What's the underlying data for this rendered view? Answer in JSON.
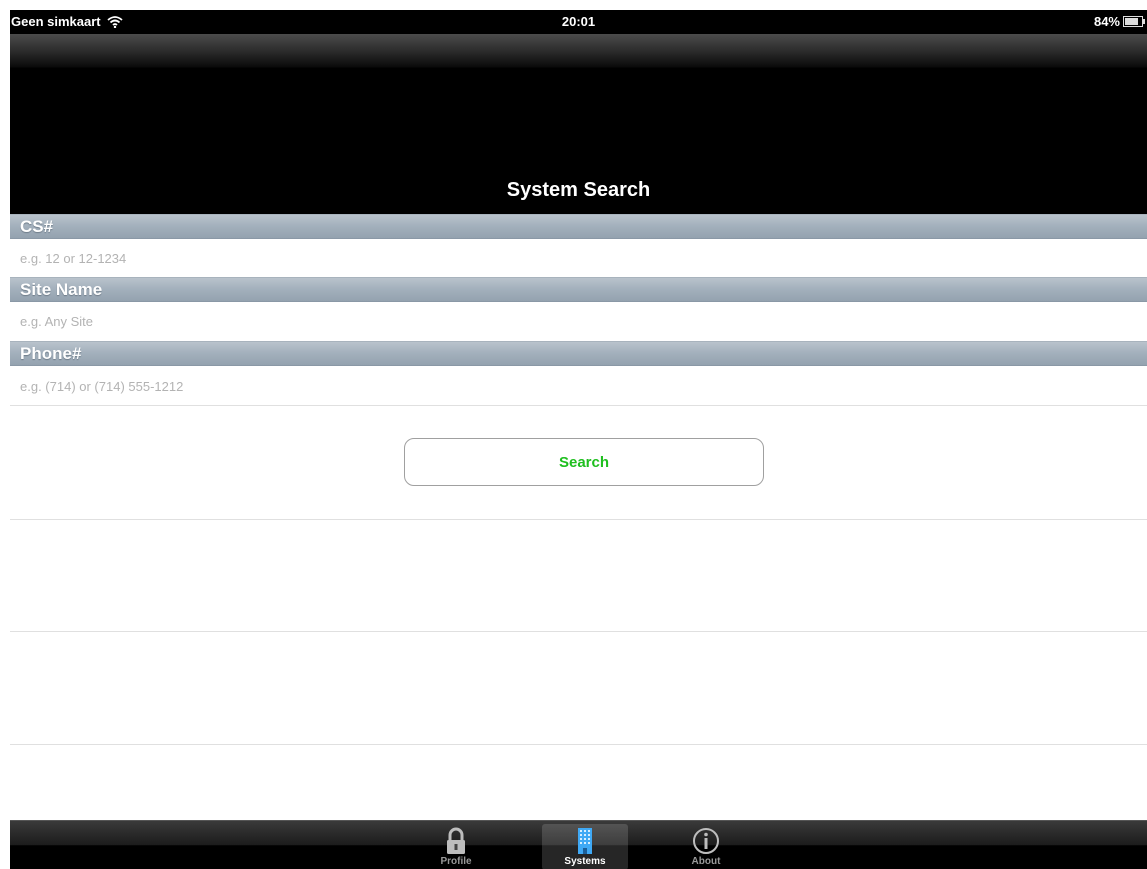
{
  "status_bar": {
    "carrier": "Geen simkaart",
    "time": "20:01",
    "battery": "84%"
  },
  "nav": {
    "title": "System Search"
  },
  "form": {
    "cs": {
      "label": "CS#",
      "value": "",
      "placeholder": "e.g. 12 or 12-1234"
    },
    "site_name": {
      "label": "Site Name",
      "value": "",
      "placeholder": "e.g. Any Site"
    },
    "phone": {
      "label": "Phone#",
      "value": "",
      "placeholder": "e.g. (714) or (714) 555-1212"
    },
    "search_label": "Search",
    "search_color": "#1fbf1f"
  },
  "tab_bar": {
    "selected": "Systems",
    "tabs": [
      {
        "label": "Profile",
        "icon": "lock-icon"
      },
      {
        "label": "Systems",
        "icon": "building-icon"
      },
      {
        "label": "About",
        "icon": "info-icon"
      }
    ]
  },
  "colors": {
    "header_bg": "#000000",
    "section_header": "#a4b1bd",
    "tab_bar": "#000000"
  }
}
